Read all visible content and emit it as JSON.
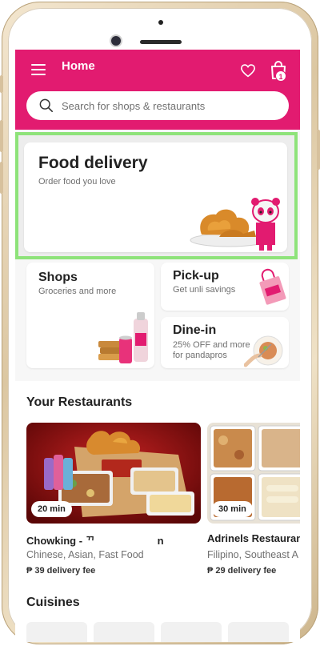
{
  "header": {
    "title": "Home",
    "cart_count": "1",
    "brand_color": "#e21b70"
  },
  "search": {
    "placeholder": "Search for shops & restaurants"
  },
  "verticals": {
    "food_delivery": {
      "title": "Food delivery",
      "subtitle": "Order food you love"
    },
    "shops": {
      "title": "Shops",
      "subtitle": "Groceries and more"
    },
    "pickup": {
      "title": "Pick-up",
      "subtitle": "Get unli savings"
    },
    "dinein": {
      "title": "Dine-in",
      "subtitle": "25% OFF and more for pandapros"
    }
  },
  "your_restaurants": {
    "title": "Your Restaurants",
    "items": [
      {
        "name": "Chowking - ",
        "name_tail": "n",
        "cuisine": "Chinese, Asian, Fast Food",
        "fee": "₱ 39 delivery fee",
        "time": "20 min"
      },
      {
        "name": "Adrinels Restaurant",
        "cuisine": "Filipino, Southeast A",
        "fee": "₱ 29 delivery fee",
        "time": "30 min"
      }
    ]
  },
  "cuisines": {
    "title": "Cuisines"
  },
  "icons": [
    "menu-icon",
    "heart-icon",
    "shopping-bag-icon",
    "search-icon"
  ]
}
